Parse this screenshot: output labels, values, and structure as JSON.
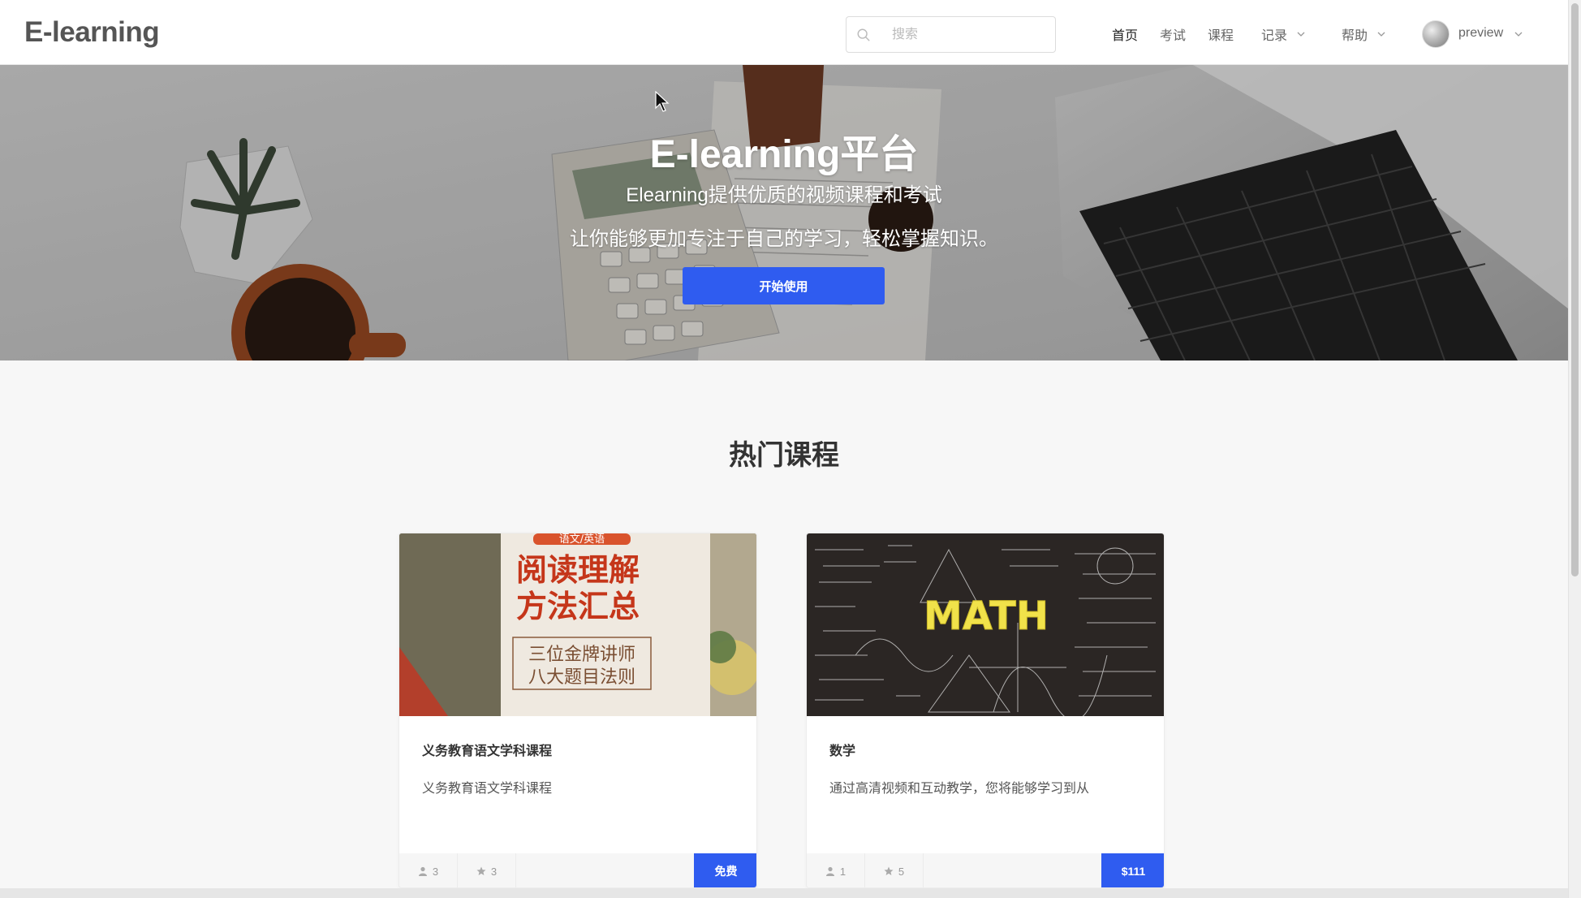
{
  "header": {
    "logo": "E-learning",
    "search_placeholder": "搜索",
    "nav": [
      {
        "label": "首页",
        "active": true
      },
      {
        "label": "考试"
      },
      {
        "label": "课程"
      },
      {
        "label": "记录",
        "dropdown": true
      },
      {
        "label": "帮助",
        "dropdown": true
      }
    ],
    "user": {
      "name": "preview"
    }
  },
  "hero": {
    "title": "E-learning平台",
    "subtitle1": "Elearning提供优质的视频课程和考试",
    "subtitle2": "让你能够更加专注于自己的学习，轻松掌握知识。",
    "button_label": "开始使用"
  },
  "section": {
    "title": "热门课程"
  },
  "courses": [
    {
      "title": "义务教育语文学科课程",
      "description": "义务教育语文学科课程",
      "students": "3",
      "stars": "3",
      "price": "免费",
      "image": {
        "tag": "语文/英语",
        "line1": "阅读理解",
        "line2": "方法汇总",
        "box1": "三位金牌讲师",
        "box2": "八大题目法则"
      }
    },
    {
      "title": "数学",
      "description": "通过高清视频和互动教学，您将能够学习到从",
      "students": "1",
      "stars": "5",
      "price": "$111",
      "image": {
        "text": "MATH"
      }
    }
  ],
  "colors": {
    "accent": "#2f5cf0"
  }
}
